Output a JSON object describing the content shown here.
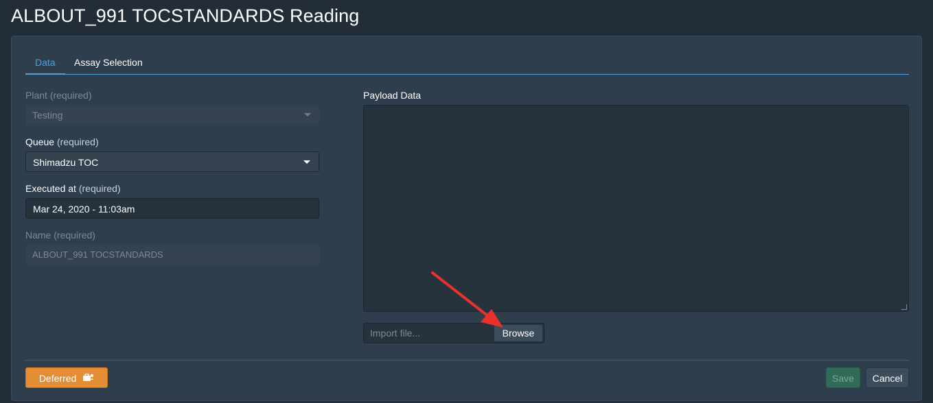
{
  "page": {
    "title": "ALBOUT_991 TOCSTANDARDS Reading"
  },
  "tabs": [
    {
      "label": "Data",
      "active": true
    },
    {
      "label": "Assay Selection",
      "active": false
    }
  ],
  "form": {
    "plant": {
      "label": "Plant",
      "required": "(required)",
      "value": "Testing"
    },
    "queue": {
      "label": "Queue",
      "required": "(required)",
      "value": "Shimadzu TOC"
    },
    "executed_at": {
      "label": "Executed at",
      "required": "(required)",
      "value": "Mar 24, 2020 - 11:03am"
    },
    "name": {
      "label": "Name",
      "required": "(required)",
      "value": "ALBOUT_991 TOCSTANDARDS"
    }
  },
  "payload": {
    "label": "Payload Data",
    "value": "",
    "import_placeholder": "Import file...",
    "browse_label": "Browse"
  },
  "footer": {
    "deferred_label": "Deferred",
    "save_label": "Save",
    "cancel_label": "Cancel"
  },
  "colors": {
    "background": "#222d38",
    "panel": "#2e3e4d",
    "accent": "#4aa3df",
    "deferred": "#e38d35",
    "save": "#2f6b57",
    "annotation_arrow": "#e8312a"
  },
  "icons": {
    "deferred": "briefcase-user-icon",
    "annotation": "red-arrow-annotation"
  }
}
